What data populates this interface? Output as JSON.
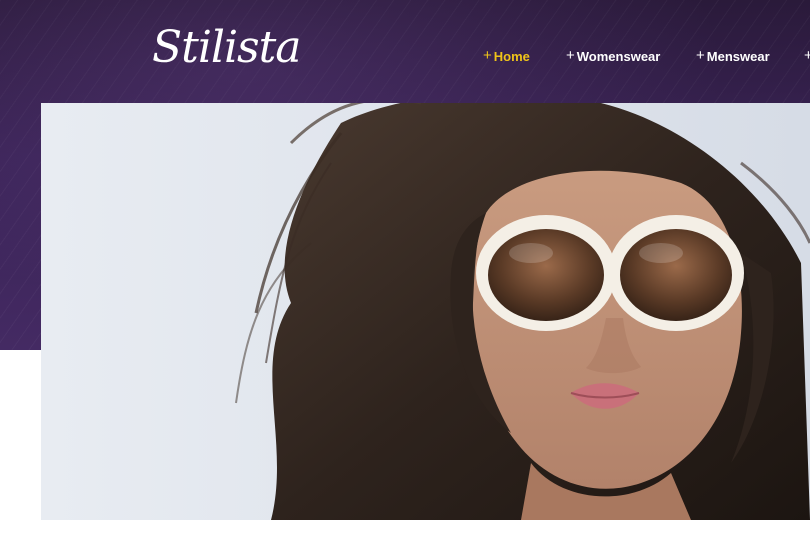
{
  "site": {
    "logo_text": "Stilista"
  },
  "nav": {
    "items": [
      {
        "label": "Home",
        "active": true
      },
      {
        "label": "Womenswear",
        "active": false
      },
      {
        "label": "Menswear",
        "active": false
      },
      {
        "label": "",
        "active": false
      }
    ],
    "plus_glyph": "+"
  },
  "hero": {
    "image_subject": "woman wearing white oversized sunglasses"
  },
  "colors": {
    "header_bg": "#3a2356",
    "nav_active": "#f0c419",
    "nav_text": "#ffffff",
    "hero_bg": "#dfe4ec"
  }
}
